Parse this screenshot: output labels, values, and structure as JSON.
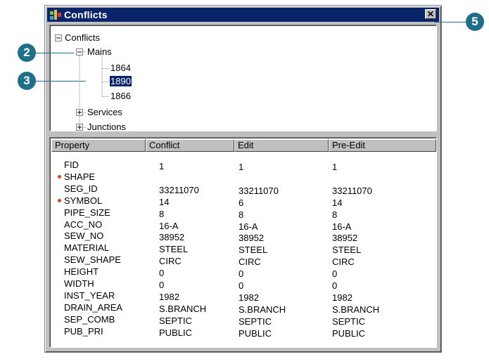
{
  "window": {
    "title": "Conflicts",
    "close_glyph": "✕"
  },
  "icons": {
    "app": "conflicts-app-icon",
    "close": "close-icon",
    "expand": "plus-box-icon",
    "collapse": "minus-box-icon"
  },
  "tree": {
    "root": {
      "label": "Conflicts",
      "state": "expanded"
    },
    "mains": {
      "label": "Mains",
      "state": "expanded"
    },
    "children": [
      "1864",
      "1890",
      "1866"
    ],
    "selected": "1890",
    "services": {
      "label": "Services",
      "state": "collapsed"
    },
    "junctions": {
      "label": "Junctions",
      "state": "collapsed"
    }
  },
  "grid": {
    "columns": [
      "Property",
      "Conflict",
      "Edit",
      "Pre-Edit"
    ],
    "rows": [
      {
        "property": "FID",
        "conflict": "1",
        "edit": "1",
        "pre_edit": "1",
        "flag": false
      },
      {
        "property": "SHAPE",
        "conflict": "",
        "edit": "",
        "pre_edit": "",
        "flag": true
      },
      {
        "property": "SEG_ID",
        "conflict": "33211070",
        "edit": "33211070",
        "pre_edit": "33211070",
        "flag": false
      },
      {
        "property": "SYMBOL",
        "conflict": "14",
        "edit": "6",
        "pre_edit": "14",
        "flag": true
      },
      {
        "property": "PIPE_SIZE",
        "conflict": "8",
        "edit": "8",
        "pre_edit": "8",
        "flag": false
      },
      {
        "property": "ACC_NO",
        "conflict": "16-A",
        "edit": "16-A",
        "pre_edit": "16-A",
        "flag": false
      },
      {
        "property": "SEW_NO",
        "conflict": "38952",
        "edit": "38952",
        "pre_edit": "38952",
        "flag": false
      },
      {
        "property": "MATERIAL",
        "conflict": "STEEL",
        "edit": "STEEL",
        "pre_edit": "STEEL",
        "flag": false
      },
      {
        "property": "SEW_SHAPE",
        "conflict": "CIRC",
        "edit": "CIRC",
        "pre_edit": "CIRC",
        "flag": false
      },
      {
        "property": "HEIGHT",
        "conflict": "0",
        "edit": "0",
        "pre_edit": "0",
        "flag": false
      },
      {
        "property": "WIDTH",
        "conflict": "0",
        "edit": "0",
        "pre_edit": "0",
        "flag": false
      },
      {
        "property": "INST_YEAR",
        "conflict": "1982",
        "edit": "1982",
        "pre_edit": "1982",
        "flag": false
      },
      {
        "property": "DRAIN_AREA",
        "conflict": "S.BRANCH",
        "edit": "S.BRANCH",
        "pre_edit": "S.BRANCH",
        "flag": false
      },
      {
        "property": "SEP_COMB",
        "conflict": "SEPTIC",
        "edit": "SEPTIC",
        "pre_edit": "SEPTIC",
        "flag": false
      },
      {
        "property": "PUB_PRI",
        "conflict": "PUBLIC",
        "edit": "PUBLIC",
        "pre_edit": "PUBLIC",
        "flag": false
      }
    ]
  },
  "callouts": [
    {
      "label": "2"
    },
    {
      "label": "3"
    },
    {
      "label": "5"
    }
  ],
  "colors": {
    "titlebar": "#0a246a",
    "callout": "#1f6f8b",
    "flag_dot": "#e2401d",
    "selection": "#0a246a"
  }
}
